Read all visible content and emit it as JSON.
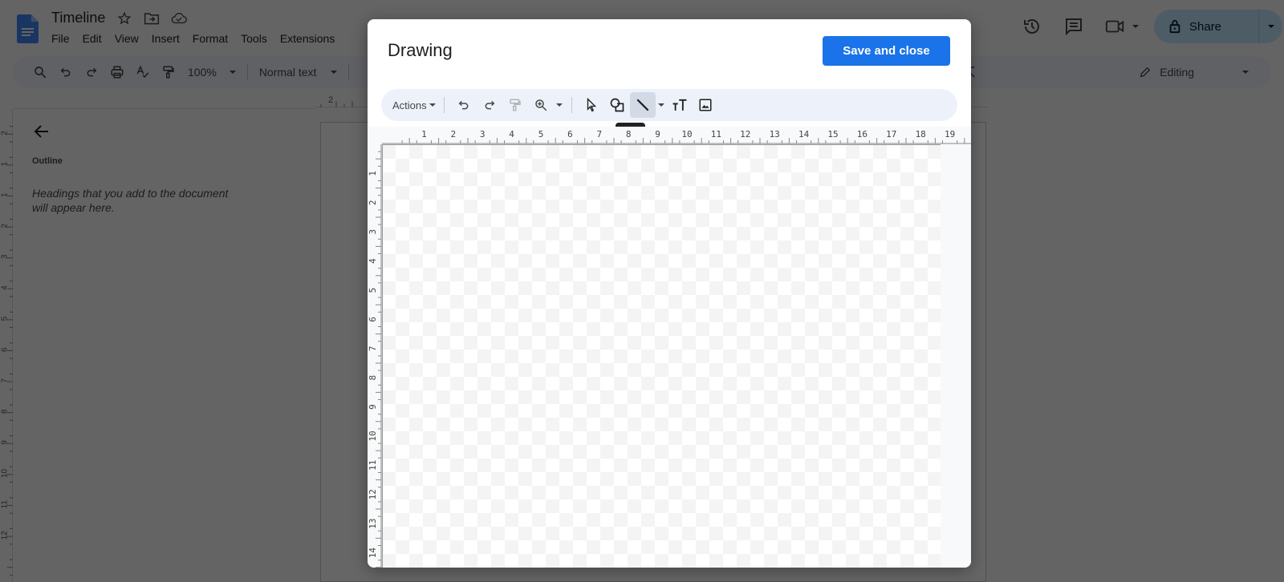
{
  "docs": {
    "title": "Timeline",
    "menu": [
      "File",
      "Edit",
      "View",
      "Insert",
      "Format",
      "Tools",
      "Extensions"
    ],
    "toolbar": {
      "zoom": "100%",
      "style": "Normal text",
      "mode": "Editing"
    },
    "share_label": "Share",
    "outline": {
      "label": "Outline",
      "hint": "Headings that you add to the document will appear here."
    },
    "hruler_visible": "2",
    "vruler_labels": [
      "2",
      "1",
      "1",
      "2",
      "3",
      "4",
      "5",
      "6",
      "7",
      "8",
      "9",
      "10",
      "11",
      "12"
    ]
  },
  "dialog": {
    "title": "Drawing",
    "save_label": "Save and close",
    "toolbar": {
      "actions_label": "Actions",
      "active_tool": "Line",
      "tooltip": "Line"
    },
    "hruler_labels": [
      "1",
      "2",
      "3",
      "4",
      "5",
      "6",
      "7",
      "8",
      "9",
      "10",
      "11",
      "12",
      "13",
      "14",
      "15",
      "16",
      "17",
      "18",
      "19"
    ],
    "vruler_labels": [
      "1",
      "2",
      "3",
      "4",
      "5",
      "6",
      "7",
      "8",
      "9",
      "10",
      "11",
      "12",
      "13",
      "14"
    ]
  },
  "colors": {
    "primary": "#1a73e8",
    "share_bg": "#c2e7ff",
    "toolbar_bg": "#edf2fa",
    "doc_blue": "#4285f4"
  }
}
